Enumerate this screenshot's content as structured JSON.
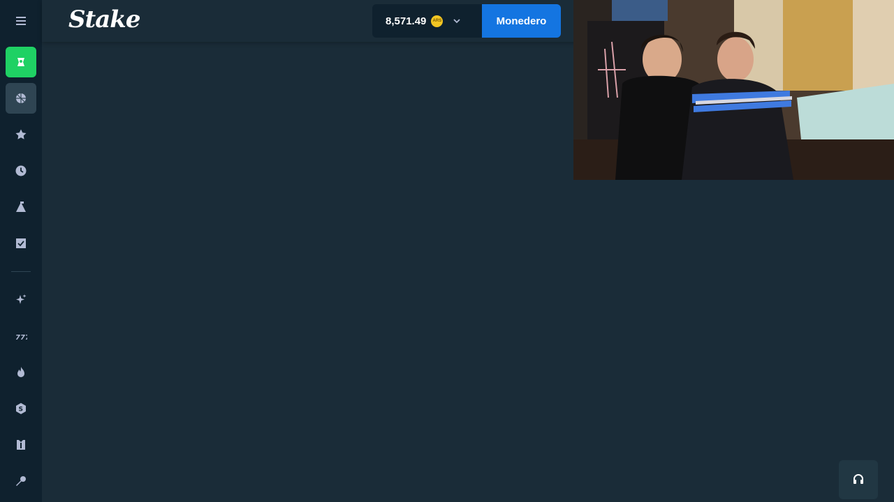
{
  "brand": {
    "logo_text": "Stake"
  },
  "header": {
    "balance": "8,571.49",
    "currency_badge": "ARS",
    "wallet_label": "Monedero"
  },
  "sidebar": {
    "items": [
      {
        "name": "menu-icon",
        "active": false
      },
      {
        "name": "casino-icon",
        "active": true
      },
      {
        "name": "sports-icon",
        "active": false
      },
      {
        "name": "favorites-star-icon",
        "active": false
      },
      {
        "name": "recent-clock-icon",
        "active": false
      },
      {
        "name": "challenges-mountain-icon",
        "active": false
      },
      {
        "name": "my-bets-icon",
        "active": false
      },
      {
        "name": "new-releases-sparkle-icon",
        "active": false
      },
      {
        "name": "slots-777-icon",
        "active": false
      },
      {
        "name": "hot-flame-icon",
        "active": false
      },
      {
        "name": "stake-originals-icon",
        "active": false
      },
      {
        "name": "live-casino-icon",
        "active": false
      },
      {
        "name": "game-shows-mic-icon",
        "active": false
      }
    ]
  },
  "colors": {
    "background": "#1a2c38",
    "sidebar": "#0f212e",
    "casino_accent": "#1fd164",
    "wallet_button": "#1475e1",
    "coin": "#f3c623"
  }
}
